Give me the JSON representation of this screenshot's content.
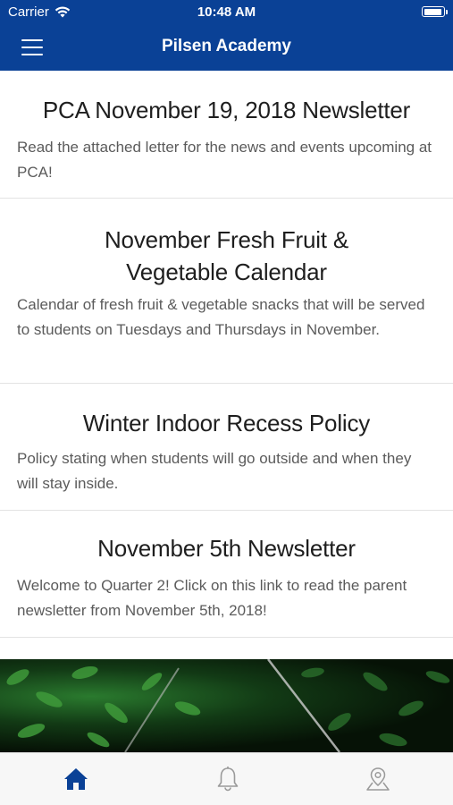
{
  "status_bar": {
    "carrier": "Carrier",
    "time": "10:48 AM"
  },
  "nav": {
    "title": "Pilsen Academy"
  },
  "posts": [
    {
      "title": "PCA November 19, 2018 Newsletter",
      "description": "Read the attached letter for the news and events upcoming at PCA!"
    },
    {
      "title": "November Fresh Fruit & Vegetable Calendar",
      "description": "Calendar of fresh fruit & vegetable snacks that will be served to students on Tuesdays and Thursdays in November."
    },
    {
      "title": "Winter Indoor Recess Policy",
      "description": "Policy stating when students will go outside and when they will stay inside."
    },
    {
      "title": "November 5th Newsletter",
      "description": "Welcome to Quarter 2! Click on this link to read the parent newsletter from November 5th, 2018!"
    }
  ],
  "tabs": [
    {
      "icon": "home-icon",
      "active": true
    },
    {
      "icon": "bell-icon",
      "active": false
    },
    {
      "icon": "map-pin-icon",
      "active": false
    }
  ],
  "colors": {
    "brand": "#0a4196",
    "active_tab": "#0a4196",
    "inactive_tab": "#9a9a9a"
  }
}
